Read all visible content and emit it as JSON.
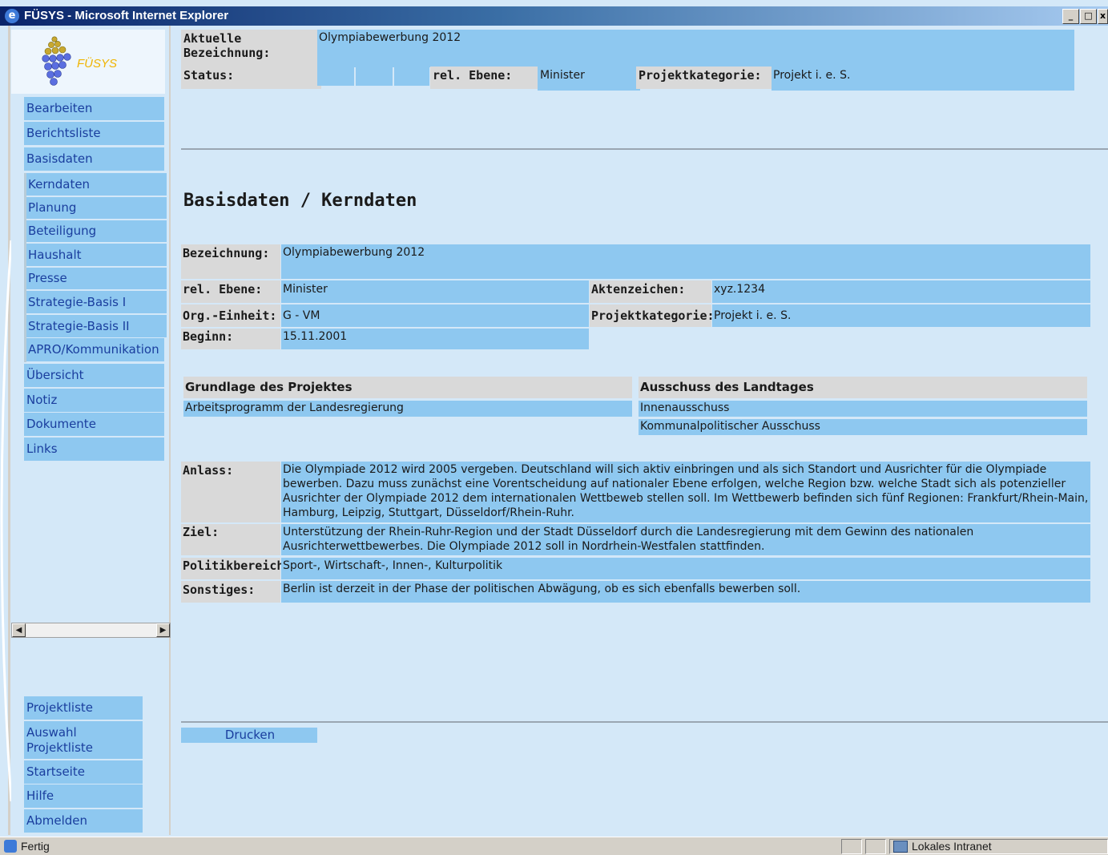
{
  "window": {
    "title": "FÜSYS - Microsoft Internet Explorer",
    "minimize_glyph": "_",
    "maximize_glyph": "□",
    "close_glyph": "x",
    "app_icon": "ie-icon"
  },
  "logo": {
    "text": "FÜSYS",
    "icon": "pyramid-logo-icon"
  },
  "header": {
    "aktuelle_label": "Aktuelle Bezeichnung:",
    "aktuelle_value": "Olympiabewerbung 2012",
    "status_label": "Status:",
    "ebene_label": "rel. Ebene:",
    "ebene_value": "Minister",
    "kategorie_label": "Projektkategorie:",
    "kategorie_value": "Projekt i. e. S."
  },
  "nav": {
    "main": [
      "Bearbeiten",
      "Berichtsliste",
      "Basisdaten"
    ],
    "sub": [
      "Kerndaten",
      "Planung",
      "Beteiligung",
      "Haushalt",
      "Presse",
      "Strategie-Basis I",
      "Strategie-Basis II",
      "APRO/Kommunikation"
    ],
    "after": [
      "Übersicht",
      "Notiz",
      "Dokumente",
      "Links"
    ],
    "bottom": [
      "Projektliste",
      "Auswahl Projektliste",
      "Startseite",
      "Hilfe",
      "Abmelden"
    ]
  },
  "page": {
    "heading": "Basisdaten / Kerndaten",
    "bezeichnung_label": "Bezeichnung:",
    "bezeichnung_value": "Olympiabewerbung 2012",
    "ebene_label": "rel. Ebene:",
    "ebene_value": "Minister",
    "aktenzeichen_label": "Aktenzeichen:",
    "aktenzeichen_value": "xyz.1234",
    "org_label": "Org.-Einheit:",
    "org_value": "G - VM",
    "kategorie_label": "Projektkategorie:",
    "kategorie_value": "Projekt i. e. S.",
    "beginn_label": "Beginn:",
    "beginn_value": "15.11.2001",
    "grundlage_header": "Grundlage des Projektes",
    "grundlage_value": "Arbeitsprogramm der Landesregierung",
    "ausschuss_header": "Ausschuss des Landtages",
    "ausschuss_values": [
      "Innenausschuss",
      "Kommunalpolitischer Ausschuss"
    ],
    "anlass_label": "Anlass:",
    "anlass_value": "Die Olympiade 2012 wird 2005 vergeben. Deutschland will sich aktiv einbringen und als sich Standort und Ausrichter für die Olympiade bewerben. Dazu muss zunächst eine Vorentscheidung auf nationaler Ebene erfolgen, welche Region bzw. welche Stadt sich als potenzieller Ausrichter der Olympiade 2012 dem internationalen Wettbeweb stellen soll. Im Wettbewerb befinden sich fünf Regionen: Frankfurt/Rhein-Main, Hamburg, Leipzig, Stuttgart, Düsseldorf/Rhein-Ruhr.",
    "ziel_label": "Ziel:",
    "ziel_value": "Unterstützung der Rhein-Ruhr-Region und der Stadt Düsseldorf durch die Landesregierung mit dem Gewinn des nationalen Ausrichterwettbewerbes. Die Olympiade 2012 soll in Nordrhein-Westfalen stattfinden.",
    "politik_label": "Politikbereich:",
    "politik_value": "Sport-, Wirtschaft-, Innen-, Kulturpolitik",
    "sonstiges_label": "Sonstiges:",
    "sonstiges_value": "Berlin ist derzeit in der Phase der politischen Abwägung, ob es sich ebenfalls bewerben soll.",
    "print_button": "Drucken"
  },
  "statusbar": {
    "left_text": "Fertig",
    "zone_text": "Lokales Intranet",
    "left_icon": "ie-page-icon",
    "zone_icon": "intranet-icon"
  },
  "colors": {
    "background": "#d4e8f8",
    "cell_blue": "#8ec8f0",
    "label_grey": "#d9d9d9",
    "nav_text": "#1a3e9e",
    "logo_text": "#f0b400"
  }
}
